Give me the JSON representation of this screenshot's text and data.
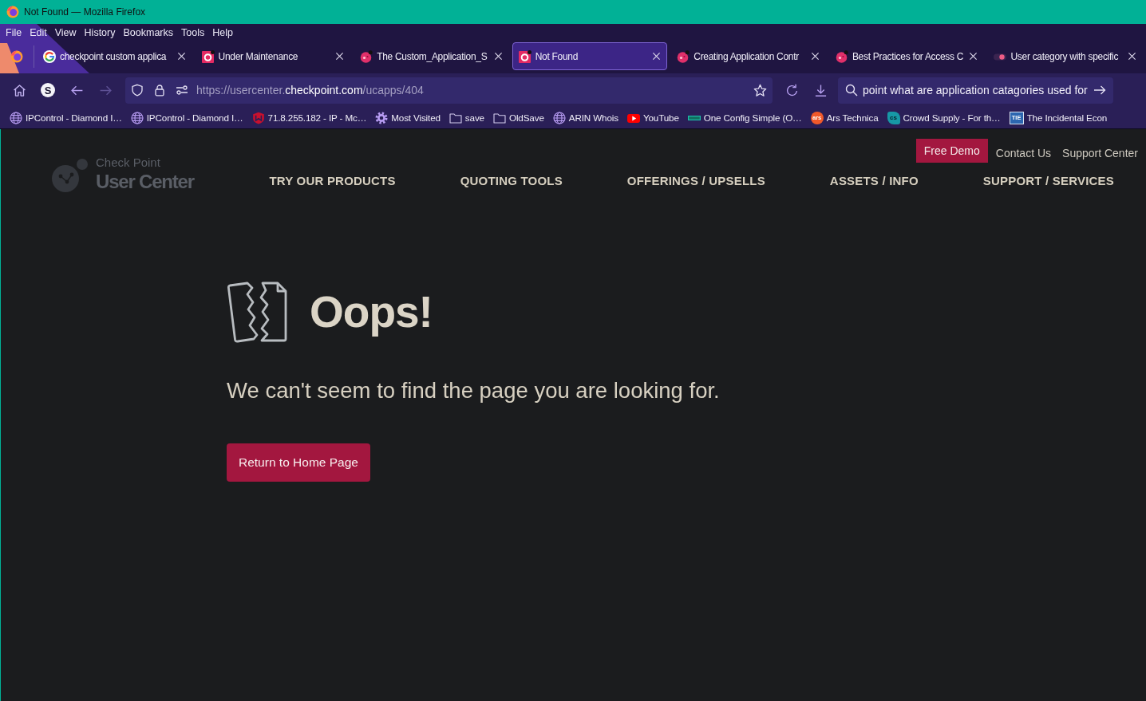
{
  "window": {
    "title": "Not Found — Mozilla Firefox"
  },
  "menu_bar": [
    "File",
    "Edit",
    "View",
    "History",
    "Bookmarks",
    "Tools",
    "Help"
  ],
  "tabs": [
    {
      "title": "checkpoint custom applica",
      "kind": "google",
      "selected": false
    },
    {
      "title": "Under Maintenance",
      "kind": "tile",
      "selected": false
    },
    {
      "title": "The Custom_Application_S",
      "kind": "ball",
      "selected": false
    },
    {
      "title": "Not Found",
      "kind": "tile",
      "selected": true
    },
    {
      "title": "Creating Application Contr",
      "kind": "ball",
      "selected": false
    },
    {
      "title": "Best Practices for Access C",
      "kind": "ball",
      "selected": false
    },
    {
      "title": "User category with specific",
      "kind": "pill",
      "selected": false
    }
  ],
  "toolbar": {
    "extension_label": "S",
    "forward_disabled": true,
    "address": {
      "scheme": "https://",
      "subdomain": "usercenter.",
      "domain": "checkpoint.com",
      "path": "/ucapps/404"
    },
    "search": {
      "value": "point what are application catagories used for"
    }
  },
  "bookmarks": [
    {
      "title": "IPControl - Diamond I…",
      "kind": "globe"
    },
    {
      "title": "IPControl - Diamond I…",
      "kind": "globe"
    },
    {
      "title": "71.8.255.182 - IP - Mc…",
      "kind": "shield"
    },
    {
      "title": "Most Visited",
      "kind": "gear"
    },
    {
      "title": "save",
      "kind": "folder"
    },
    {
      "title": "OldSave",
      "kind": "folder"
    },
    {
      "title": "ARIN Whois",
      "kind": "globe"
    },
    {
      "title": "YouTube",
      "kind": "play"
    },
    {
      "title": "One Config Simple (O…",
      "kind": "bar"
    },
    {
      "title": "Ars Technica",
      "kind": "round",
      "icon_text": "ars"
    },
    {
      "title": "Crowd Supply - For th…",
      "kind": "diamond",
      "icon_text": "cs"
    },
    {
      "title": "The Incidental Econ",
      "kind": "square",
      "icon_text": "TIE"
    }
  ],
  "page": {
    "header": {
      "logo": {
        "line_1": "Check Point",
        "line_2": "User Center"
      },
      "cta": "Free Demo",
      "links": [
        "Contact Us",
        "Support Center"
      ],
      "nav": [
        "TRY OUR PRODUCTS",
        "QUOTING TOOLS",
        "OFFERINGS / UPSELLS",
        "ASSETS / INFO",
        "SUPPORT / SERVICES"
      ]
    },
    "main": {
      "title": "Oops!",
      "message": "We can't seem to find the page you are looking for.",
      "button": "Return to Home Page"
    }
  }
}
